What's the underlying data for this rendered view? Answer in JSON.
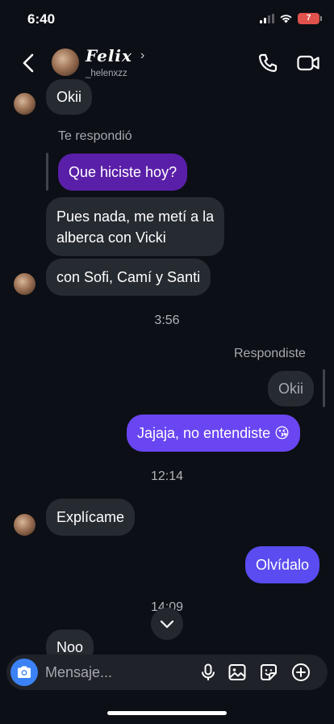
{
  "status_bar": {
    "time": "6:40",
    "battery": "7"
  },
  "header": {
    "name": "Felix",
    "username": "_helenxzz"
  },
  "messages": {
    "okii_in": "Okii",
    "reply_label_in": "Te respondió",
    "quoted_out": "Que hiciste hoy?",
    "pues_line1": "Pues nada, me metí a la",
    "pues_line2": "alberca con Vicki",
    "con_sofi": "con Sofi, Camí y Santi",
    "time_1": "3:56",
    "reply_label_out": "Respondiste",
    "quoted_okii": "Okii",
    "jajaja": "Jajaja, no entendiste 😘",
    "time_2": "12:14",
    "explicame": "Explícame",
    "olvidalo": "Olvídalo",
    "time_3": "14:09",
    "noo": "Noo"
  },
  "composer": {
    "placeholder": "Mensaje..."
  },
  "colors": {
    "outgoing": "#6a46f2",
    "incoming": "#262a31",
    "quoted_out": "#5a1fa8",
    "camera": "#3b82f6"
  }
}
